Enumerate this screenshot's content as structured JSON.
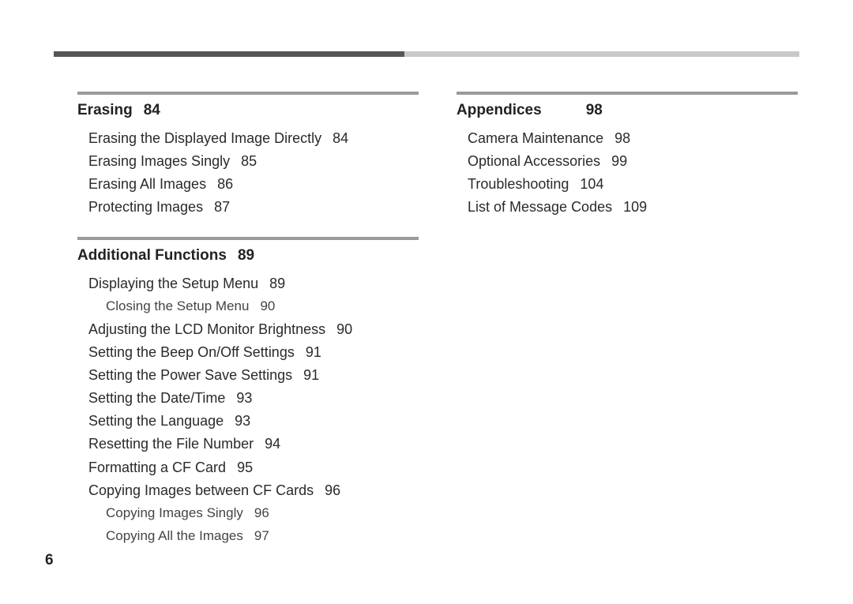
{
  "pageNumber": "6",
  "leftColumn": [
    {
      "title": "Erasing",
      "page": "84",
      "pgClass": "",
      "entries": [
        {
          "type": "entry",
          "title": "Erasing the Displayed Image Directly",
          "page": "84"
        },
        {
          "type": "entry",
          "title": "Erasing Images Singly",
          "page": "85"
        },
        {
          "type": "entry",
          "title": "Erasing All Images",
          "page": "86"
        },
        {
          "type": "entry",
          "title": "Protecting Images",
          "page": "87"
        }
      ]
    },
    {
      "title": "Additional Functions",
      "page": "89",
      "pgClass": "",
      "entries": [
        {
          "type": "entry",
          "title": "Displaying the Setup Menu",
          "page": "89"
        },
        {
          "type": "subentry",
          "title": "Closing the Setup Menu",
          "page": "90"
        },
        {
          "type": "entry",
          "title": "Adjusting the LCD Monitor Brightness",
          "page": "90"
        },
        {
          "type": "entry",
          "title": "Setting the Beep On/Off Settings",
          "page": "91"
        },
        {
          "type": "entry",
          "title": "Setting the Power Save Settings",
          "page": "91"
        },
        {
          "type": "entry",
          "title": "Setting the Date/Time",
          "page": "93"
        },
        {
          "type": "entry",
          "title": "Setting the Language",
          "page": "93"
        },
        {
          "type": "entry",
          "title": "Resetting the File Number",
          "page": "94"
        },
        {
          "type": "entry",
          "title": "Formatting a CF Card",
          "page": "95"
        },
        {
          "type": "entry",
          "title": "Copying Images between CF Cards",
          "page": "96"
        },
        {
          "type": "subentry",
          "title": "Copying Images Singly",
          "page": "96"
        },
        {
          "type": "subentry",
          "title": "Copying All the Images",
          "page": "97"
        }
      ]
    }
  ],
  "rightColumn": [
    {
      "title": "Appendices",
      "page": "98",
      "pgClass": "wide",
      "entries": [
        {
          "type": "entry",
          "title": "Camera Maintenance",
          "page": "98"
        },
        {
          "type": "entry",
          "title": "Optional Accessories",
          "page": "99"
        },
        {
          "type": "entry",
          "title": "Troubleshooting",
          "page": "104"
        },
        {
          "type": "entry",
          "title": "List of Message Codes",
          "page": "109"
        }
      ]
    }
  ]
}
